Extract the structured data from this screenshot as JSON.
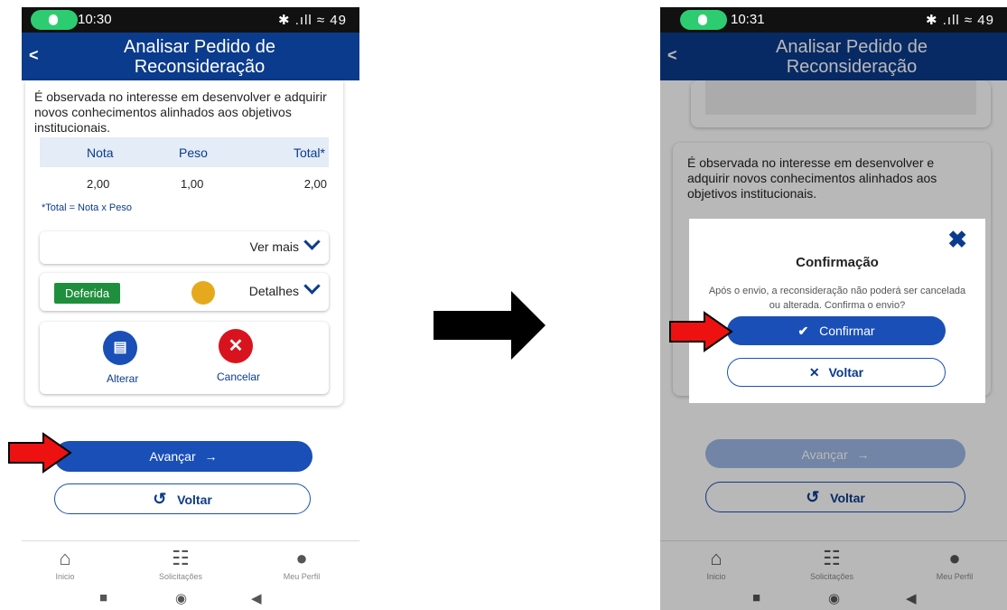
{
  "screen1": {
    "status_time": "10:30",
    "status_right": "✱ .ıll ≈ 49",
    "appbar": {
      "title": "Analisar Pedido de Reconsideração",
      "back": "<"
    },
    "description": "É observada no interesse em desenvolver e adquirir novos conhecimentos alinhados aos objetivos institucionais.",
    "table": {
      "headers": [
        "Nota",
        "Peso",
        "Total*"
      ],
      "values": [
        "2,00",
        "1,00",
        "2,00"
      ],
      "footnote": "*Total = Nota x Peso"
    },
    "ver_mais": "Ver mais",
    "status_badge": "Deferida",
    "detalhes": "Detalhes",
    "alterar": "Alterar",
    "cancelar": "Cancelar",
    "avancar": "Avançar",
    "voltar": "Voltar"
  },
  "screen2": {
    "status_time": "10:31",
    "status_right": "✱ .ıll ≈ 49",
    "appbar": {
      "title": "Analisar Pedido de Reconsideração",
      "back": "<"
    },
    "description": "É observada no interesse em desenvolver e adquirir novos conhecimentos alinhados aos objetivos institucionais.",
    "dialog": {
      "title": "Confirmação",
      "message": "Após o envio, a reconsideração não poderá ser cancelada ou alterada. Confirma o envio?",
      "confirm": "Confirmar",
      "back": "Voltar"
    },
    "avancar": "Avançar",
    "voltar": "Voltar"
  },
  "bottom_nav": [
    "Inicio",
    "Solicitações",
    "Meu Perfil"
  ],
  "colors": {
    "primary": "#0b3b8c",
    "button": "#1a4fb8",
    "success": "#1f8f3d",
    "danger": "#d9131e",
    "warning": "#e6a91d"
  },
  "icons": [
    "home-icon",
    "clipboard-icon",
    "user-icon",
    "document-icon",
    "close-icon",
    "handshake-icon",
    "check-icon",
    "undo-icon",
    "arrow-right-icon",
    "chevron-down-icon"
  ]
}
